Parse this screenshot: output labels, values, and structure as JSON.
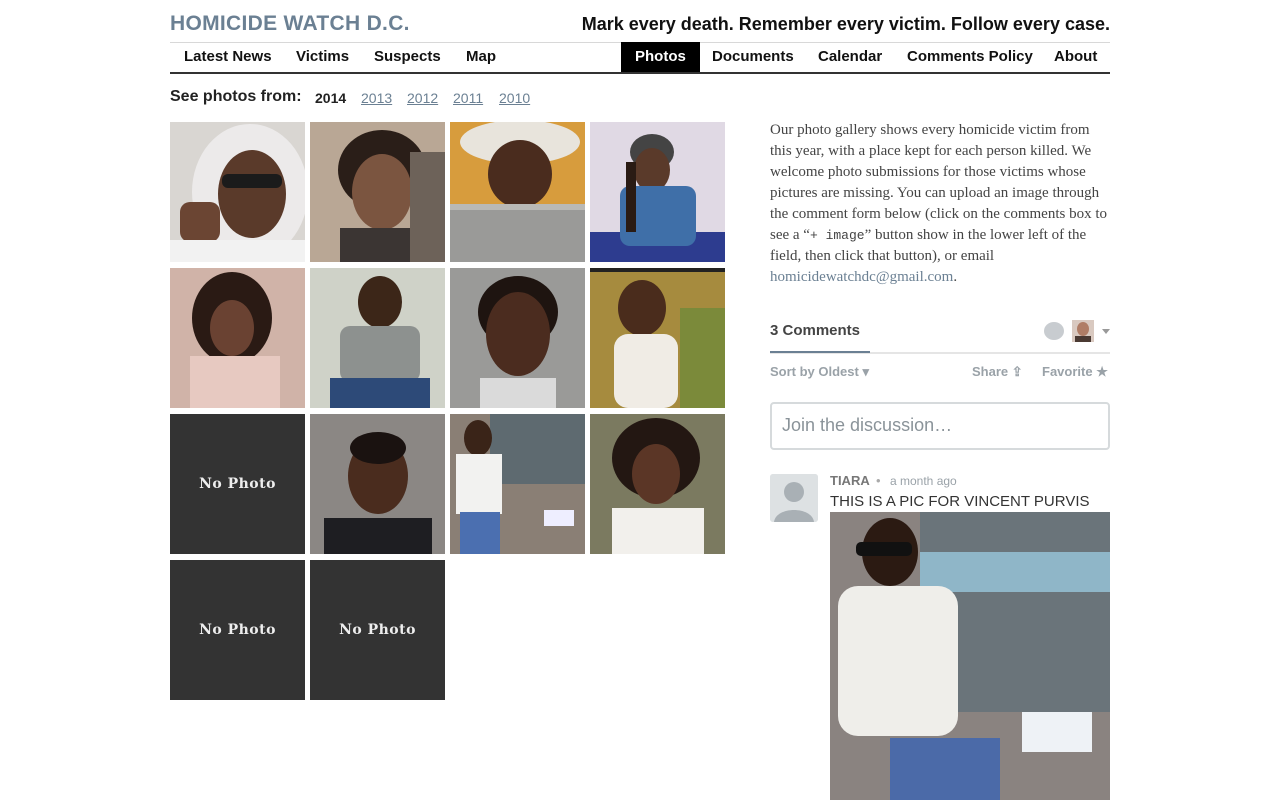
{
  "site": {
    "title": "HOMICIDE WATCH D.C.",
    "tagline": "Mark every death. Remember every victim. Follow every case."
  },
  "nav": {
    "items": [
      {
        "label": "Latest News",
        "active": false
      },
      {
        "label": "Victims",
        "active": false
      },
      {
        "label": "Suspects",
        "active": false
      },
      {
        "label": "Map",
        "active": false
      },
      {
        "label": "Photos",
        "active": true
      },
      {
        "label": "Documents",
        "active": false
      },
      {
        "label": "Calendar",
        "active": false
      },
      {
        "label": "Comments Policy",
        "active": false
      },
      {
        "label": "About",
        "active": false
      }
    ]
  },
  "years": {
    "label": "See photos from:",
    "items": [
      "2014",
      "2013",
      "2012",
      "2011",
      "2010"
    ],
    "current": "2014"
  },
  "gallery": {
    "no_photo_label": "No Photo",
    "tiles": [
      {
        "has_photo": true
      },
      {
        "has_photo": true
      },
      {
        "has_photo": true
      },
      {
        "has_photo": true
      },
      {
        "has_photo": true
      },
      {
        "has_photo": true
      },
      {
        "has_photo": true
      },
      {
        "has_photo": true
      },
      {
        "has_photo": false
      },
      {
        "has_photo": true
      },
      {
        "has_photo": true
      },
      {
        "has_photo": true
      },
      {
        "has_photo": false
      },
      {
        "has_photo": false
      }
    ]
  },
  "intro": {
    "text_before": "Our photo gallery shows every homicide victim from this year, with a place kept for each person killed. We welcome photo submissions for those victims whose pictures are missing. You can upload an image through the comment form below (click on the comments box to see a “",
    "code": "+ image",
    "text_after": "” button show in the lower left of the field, then click that button), or email ",
    "email": "homicidewatchdc@gmail.com",
    "end": "."
  },
  "comments": {
    "count_label": "3 Comments",
    "sort_label": "Sort by Oldest",
    "share_label": "Share",
    "favorite_label": "Favorite",
    "join_placeholder": "Join the discussion…",
    "items": [
      {
        "author": "TIARA",
        "time": "a month ago",
        "text": "THIS IS A PIC FOR VINCENT PURVIS"
      }
    ]
  },
  "colors": {
    "accent": "#6b8093",
    "nav_active_bg": "#000000",
    "no_photo_bg": "#333333"
  }
}
